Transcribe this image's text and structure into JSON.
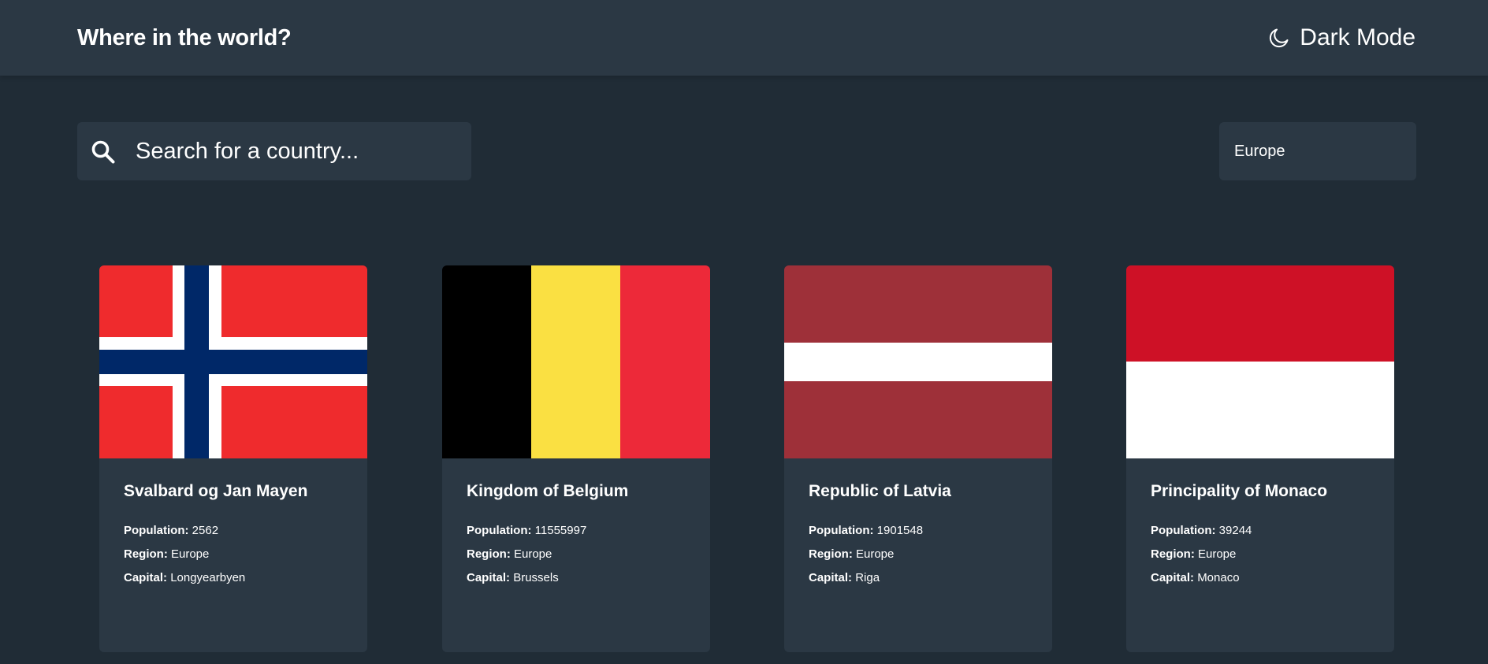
{
  "header": {
    "title": "Where in the world?",
    "theme_toggle_label": "Dark Mode",
    "theme_icon": "moon-icon"
  },
  "search": {
    "placeholder": "Search for a country...",
    "value": "",
    "icon": "search-icon"
  },
  "filter": {
    "selected": "Europe"
  },
  "labels": {
    "population": "Population:",
    "region": "Region:",
    "capital": "Capital:"
  },
  "countries": [
    {
      "name": "Svalbard og Jan Mayen",
      "population": "2562",
      "region": "Europe",
      "capital": "Longyearbyen",
      "flag": "svalbard-flag",
      "flag_colors": [
        "#ef2b2d",
        "#ffffff",
        "#002868"
      ]
    },
    {
      "name": "Kingdom of Belgium",
      "population": "11555997",
      "region": "Europe",
      "capital": "Brussels",
      "flag": "belgium-flag",
      "flag_colors": [
        "#000000",
        "#fae042",
        "#ed2939"
      ]
    },
    {
      "name": "Republic of Latvia",
      "population": "1901548",
      "region": "Europe",
      "capital": "Riga",
      "flag": "latvia-flag",
      "flag_colors": [
        "#9e3039",
        "#ffffff"
      ]
    },
    {
      "name": "Principality of Monaco",
      "population": "39244",
      "region": "Europe",
      "capital": "Monaco",
      "flag": "monaco-flag",
      "flag_colors": [
        "#ce1126",
        "#ffffff"
      ]
    }
  ],
  "colors": {
    "background": "#202c36",
    "element": "#2b3844",
    "text": "#ffffff"
  }
}
